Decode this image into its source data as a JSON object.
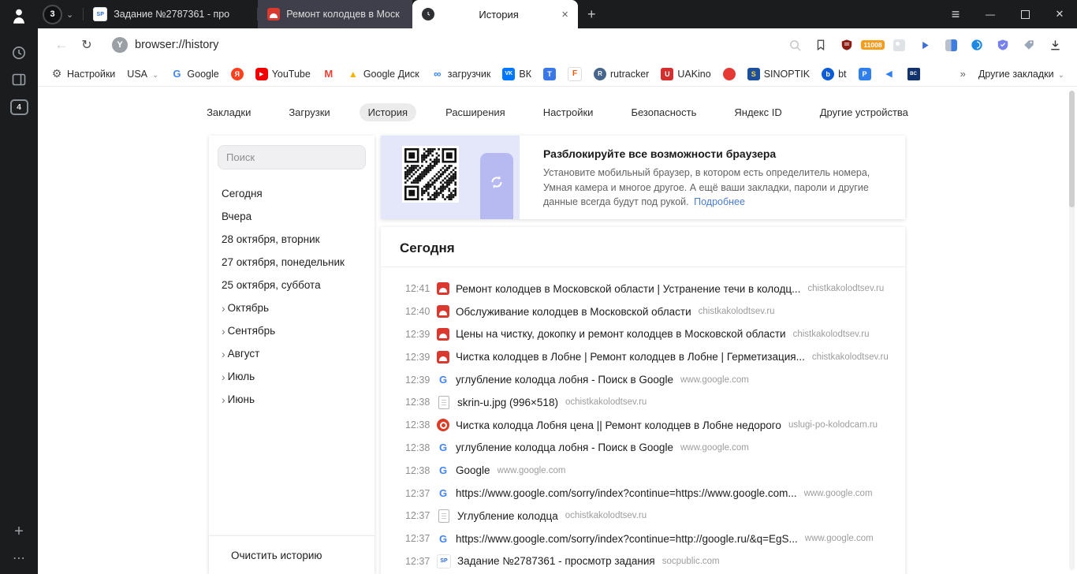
{
  "window": {
    "tab_group": {
      "count": "3"
    },
    "tabs": [
      {
        "label": "Задание №2787361 - про",
        "favicon_text": "SP"
      },
      {
        "label": "Ремонт колодцев в Моск"
      },
      {
        "label": "История"
      }
    ]
  },
  "sidebar": {
    "tab_count_badge": "4"
  },
  "addressbar": {
    "url": "browser://history",
    "counter_badge": "11008"
  },
  "bookmarks_bar": {
    "items": [
      {
        "label": "Настройки",
        "icon": "gear"
      },
      {
        "label": "USA",
        "icon": "none",
        "chevron": true
      },
      {
        "label": "Google",
        "icon": "google"
      },
      {
        "label": "",
        "icon": "yandex"
      },
      {
        "label": "YouTube",
        "icon": "youtube"
      },
      {
        "label": "",
        "icon": "gmail"
      },
      {
        "label": "Google Диск",
        "icon": "gdrive"
      },
      {
        "label": "загрузчик",
        "icon": "loader"
      },
      {
        "label": "ВК",
        "icon": "vk"
      },
      {
        "label": "",
        "icon": "translate"
      },
      {
        "label": "",
        "icon": "f"
      },
      {
        "label": "rutracker",
        "icon": "rutracker"
      },
      {
        "label": "UAKino",
        "icon": "uakino"
      },
      {
        "label": "",
        "icon": "reddot"
      },
      {
        "label": "SINOPTIK",
        "icon": "sinoptik"
      },
      {
        "label": "bt",
        "icon": "bt"
      },
      {
        "label": "",
        "icon": "p"
      },
      {
        "label": "",
        "icon": "arrow"
      },
      {
        "label": "",
        "icon": "bc"
      }
    ],
    "overflow": "»",
    "other_bookmarks": "Другие закладки"
  },
  "content": {
    "nav": {
      "items": [
        "Закладки",
        "Загрузки",
        "История",
        "Расширения",
        "Настройки",
        "Безопасность",
        "Яндекс ID",
        "Другие устройства"
      ],
      "active_index": 2
    },
    "filter_panel": {
      "search_placeholder": "Поиск",
      "dates": [
        {
          "label": "Сегодня",
          "expandable": false
        },
        {
          "label": "Вчера",
          "expandable": false
        },
        {
          "label": "28 октября, вторник",
          "expandable": false
        },
        {
          "label": "27 октября, понедельник",
          "expandable": false
        },
        {
          "label": "25 октября, суббота",
          "expandable": false
        },
        {
          "label": "Октябрь",
          "expandable": true
        },
        {
          "label": "Сентябрь",
          "expandable": true
        },
        {
          "label": "Август",
          "expandable": true
        },
        {
          "label": "Июль",
          "expandable": true
        },
        {
          "label": "Июнь",
          "expandable": true
        }
      ],
      "clear_history": "Очистить историю"
    },
    "promo": {
      "title": "Разблокируйте все возможности браузера",
      "body": "Установите мобильный браузер, в котором есть определитель номера, Умная камера и многое другое. А ещё ваши закладки, пароли и другие данные всегда будут под рукой.",
      "link": "Подробнее"
    },
    "history": {
      "section_title": "Сегодня",
      "rows": [
        {
          "time": "12:41",
          "icon": "chistka",
          "title": "Ремонт колодцев в Московской области | Устранение течи в колодц...",
          "domain": "chistkakolodtsev.ru"
        },
        {
          "time": "12:40",
          "icon": "chistka",
          "title": "Обслуживание колодцев в Московской области",
          "domain": "chistkakolodtsev.ru"
        },
        {
          "time": "12:39",
          "icon": "chistka",
          "title": "Цены на чистку, докопку и ремонт колодцев в Московской области",
          "domain": "chistkakolodtsev.ru"
        },
        {
          "time": "12:39",
          "icon": "chistka",
          "title": "Чистка колодцев в Лобне | Ремонт колодцев в Лобне | Герметизация...",
          "domain": "chistkakolodtsev.ru"
        },
        {
          "time": "12:39",
          "icon": "google",
          "title": "углубление колодца лобня - Поиск в Google",
          "domain": "www.google.com"
        },
        {
          "time": "12:38",
          "icon": "file",
          "title": "skrin-u.jpg (996×518)",
          "domain": "ochistkakolodtsev.ru"
        },
        {
          "time": "12:38",
          "icon": "uslugi",
          "title": "Чистка колодца Лобня цена || Ремонт колодцев в Лобне недорого",
          "domain": "uslugi-po-kolodcam.ru"
        },
        {
          "time": "12:38",
          "icon": "google",
          "title": "углубление колодца лобня - Поиск в Google",
          "domain": "www.google.com"
        },
        {
          "time": "12:38",
          "icon": "google",
          "title": "Google",
          "domain": "www.google.com"
        },
        {
          "time": "12:37",
          "icon": "google",
          "title": "https://www.google.com/sorry/index?continue=https://www.google.com...",
          "domain": "www.google.com"
        },
        {
          "time": "12:37",
          "icon": "file",
          "title": "Углубление колодца",
          "domain": "ochistkakolodtsev.ru"
        },
        {
          "time": "12:37",
          "icon": "google",
          "title": "https://www.google.com/sorry/index?continue=http://google.ru/&q=EgS...",
          "domain": "www.google.com"
        },
        {
          "time": "12:37",
          "icon": "sp",
          "title": "Задание №2787361 - просмотр задания",
          "domain": "socpublic.com"
        }
      ]
    }
  },
  "colors": {
    "chrome_bg": "#1b1c1e",
    "active_tab_bg": "#ffffff",
    "accent_link": "#4a7bd5",
    "chistka_red": "#d9392f",
    "uslugi_red": "#de3b26",
    "promo_bg": "#e4e6f9"
  }
}
